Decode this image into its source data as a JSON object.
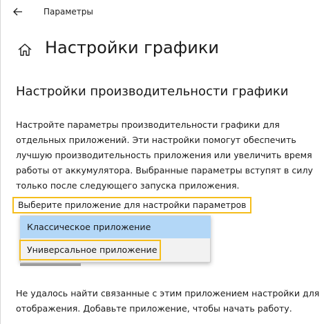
{
  "window": {
    "title": "Параметры"
  },
  "header": {
    "page_title": "Настройки графики"
  },
  "section": {
    "title": "Настройки производительности графики",
    "description": "Настройте параметры производительности графики для отдельных приложений. Эти настройки помогут обеспечить лучшую производительность приложения или увеличить время работы от аккумулятора. Выбранные параметры вступят в силу только после следующего запуска приложения."
  },
  "app_select": {
    "label": "Выберите приложение для настройки параметров",
    "options": [
      {
        "label": "Классическое приложение",
        "selected": true
      },
      {
        "label": "Универсальное приложение",
        "selected": false
      }
    ]
  },
  "footer": {
    "message": "Не удалось найти связанные с этим приложением настройки для отображения. Добавьте приложение, чтобы начать работу."
  },
  "icons": {
    "back": "back-arrow-icon",
    "home": "home-icon"
  },
  "colors": {
    "highlight_border": "#f5bd1b",
    "selected_item": "#b3d7f7",
    "dropdown_bg": "#f2f2f2"
  }
}
